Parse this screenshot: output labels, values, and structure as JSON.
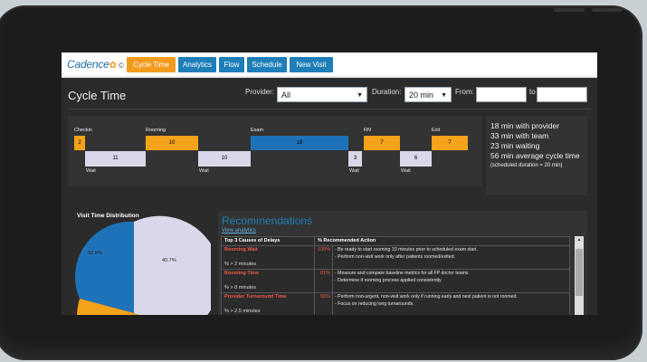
{
  "nav": {
    "logo": "Cadence",
    "copyright": "©",
    "items": [
      {
        "label": "Cycle Time",
        "active": true
      },
      {
        "label": "Analytics",
        "active": false
      },
      {
        "label": "Flow",
        "active": false
      },
      {
        "label": "Schedule",
        "active": false
      },
      {
        "label": "New Visit",
        "active": false
      }
    ]
  },
  "page": {
    "title": "Cycle Time",
    "provider_label": "Provider:",
    "provider_value": "All",
    "duration_label": "Duration:",
    "duration_value": "20 min",
    "from_label": "From:",
    "to_label": "to"
  },
  "timeline": {
    "stages": [
      {
        "label": "Checkin",
        "value": "2"
      },
      {
        "label": "Rooming",
        "value": "10"
      },
      {
        "label": "Exam",
        "value": "18"
      },
      {
        "label": "RN",
        "value": "7"
      },
      {
        "label": "Exit",
        "value": "7"
      }
    ],
    "waits": [
      {
        "label": "Wait",
        "value": "11"
      },
      {
        "label": "Wait",
        "value": "10"
      },
      {
        "label": "Wait",
        "value": "3"
      },
      {
        "label": "Wait",
        "value": "6"
      }
    ],
    "colors": {
      "stage": "#f5a31a",
      "exam": "#1e73b8",
      "wait": "#d9d8ea"
    }
  },
  "summary": {
    "line1": "18 min with provider",
    "line2": "33 min with team",
    "line3": "23 min waiting",
    "line4": "56 min average cycle time",
    "note": "(scheduled duration = 20 min)"
  },
  "visit_time": {
    "title": "Visit Time Distribution",
    "slice1": "32.8%",
    "slice2": "40.7%",
    "colors": [
      "#1e73b8",
      "#d9d8ea",
      "#f5a31a"
    ]
  },
  "recommendations": {
    "title": "Recommendations",
    "link": "View analytics",
    "col1": "Top 3 Causes of Delays",
    "col2": "% Recommended Action",
    "rows": [
      {
        "cause": "Rooming Wait",
        "sub": "% > 2 minutes",
        "pct": "100%",
        "action1": "- Be ready to start rooming 10 minutes prior to scheduled exam start.",
        "action2": "- Perform non-visit work only after patients roomed/exited."
      },
      {
        "cause": "Rooming Time",
        "sub": "% > 8 minutes",
        "pct": "81%",
        "action1": "- Measure and compare baseline metrics for all FP doctor teams",
        "action2": "- Determine if rooming process applied consistently."
      },
      {
        "cause": "Provider Turnaround Time",
        "sub": "% > 2.5 minutes",
        "pct": "56%",
        "action1": "- Perform non-urgent, non-visit work only if running early and next patient is not roomed.",
        "action2": "- Focus on reducing long turnarounds."
      }
    ]
  }
}
